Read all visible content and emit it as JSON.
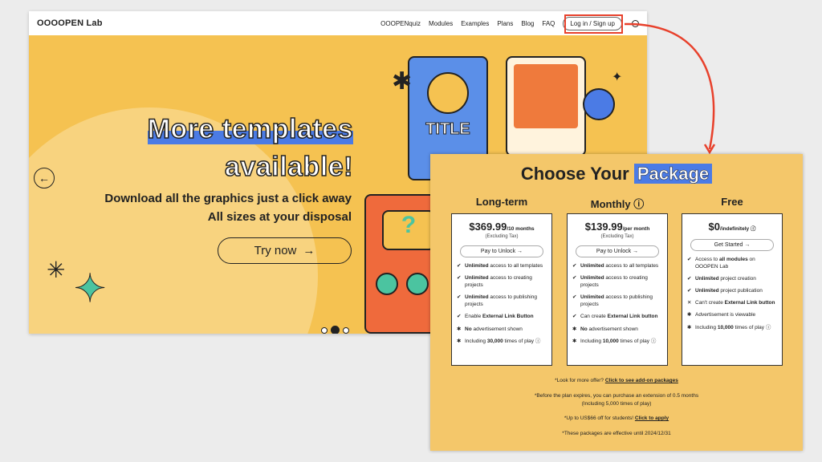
{
  "nav": {
    "logo": "OOOOPEN Lab",
    "links": [
      "OOOPENquiz",
      "Modules",
      "Examples",
      "Plans",
      "Blog",
      "FAQ"
    ],
    "login": "Log in / Sign up"
  },
  "hero": {
    "title_line1": "More templates",
    "title_line2": "available!",
    "sub1": "Download all the graphics just a click away",
    "sub2": "All sizes at your disposal",
    "cta": "Try now",
    "card_title": "TITLE",
    "carousel_active": 2,
    "carousel_count": 3
  },
  "pricing": {
    "title": "Choose Your",
    "title_highlight": "Package",
    "plans": [
      {
        "name": "Long-term",
        "price": "$369.99",
        "period": "/10 months",
        "tax": "(Excluding Tax)",
        "button": "Pay to Unlock →",
        "features": [
          [
            "✔",
            "Unlimited",
            " access to all templates"
          ],
          [
            "✔",
            "Unlimited",
            " access to creating projects"
          ],
          [
            "✔",
            "Unlimited",
            " access to publishing projects"
          ],
          [
            "✔",
            "Enable ",
            "External Link Button"
          ],
          [
            "✱",
            "No",
            " advertisement shown"
          ],
          [
            "✱",
            "Including ",
            "30,000",
            " times of play ⓘ"
          ]
        ]
      },
      {
        "name": "Monthly ⓘ",
        "price": "$139.99",
        "period": "/per month",
        "tax": "(Excluding Tax)",
        "button": "Pay to Unlock →",
        "features": [
          [
            "✔",
            "Unlimited",
            " access to all templates"
          ],
          [
            "✔",
            "Unlimited",
            " access to creating projects"
          ],
          [
            "✔",
            "Unlimited",
            " access to publishing projects"
          ],
          [
            "✔",
            "Can create ",
            "External Link button"
          ],
          [
            "✱",
            "No",
            " advertisement shown"
          ],
          [
            "✱",
            "Including ",
            "10,000",
            " times of play ⓘ"
          ]
        ]
      },
      {
        "name": "Free",
        "price": "$0",
        "period": "/indefinitely ⓘ",
        "tax": "",
        "button": "Get Started →",
        "features": [
          [
            "✔",
            "Access to ",
            "all modules",
            " on OOOPEN Lab"
          ],
          [
            "✔",
            "Unlimited",
            " project creation"
          ],
          [
            "✔",
            "Unlimited",
            " project publication"
          ],
          [
            "✕",
            "Can't create ",
            "External Link button"
          ],
          [
            "✱",
            "Advertisement is viewable"
          ],
          [
            "✱",
            "Including ",
            "10,000",
            " times of play ⓘ"
          ]
        ]
      }
    ],
    "notes": {
      "n1": "*Look for more offer? ",
      "n1_link": "Click to see add-on packages",
      "n2": "*Before the plan expires, you can purchase an extension of 0.5 months",
      "n2b": "(Including 5,000 times of play)",
      "n3": "*Up to US$66 off for students! ",
      "n3_link": "Click to apply",
      "n4": "*These packages are effective until 2024/12/31"
    }
  },
  "colors": {
    "hero": "#f5c251",
    "panel": "#f4c76a",
    "accent": "#4b7be5",
    "annotation": "#e8412c"
  }
}
